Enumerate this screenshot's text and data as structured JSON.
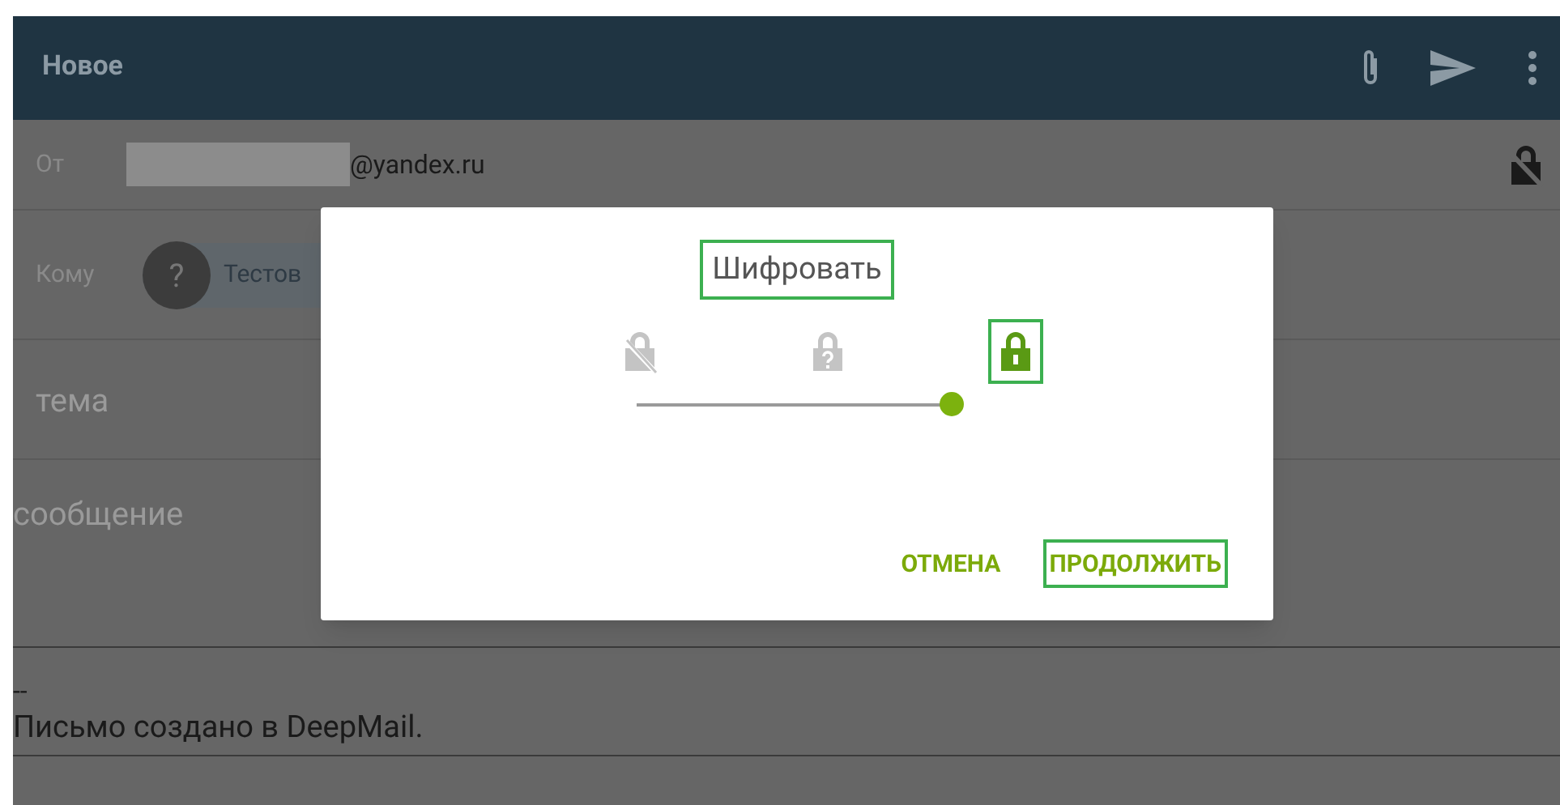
{
  "toolbar": {
    "title": "Новое"
  },
  "from": {
    "label": "От",
    "address": "@yandex.ru"
  },
  "to": {
    "label": "Кому",
    "avatar": "?",
    "recipient": "Тестов"
  },
  "subject": {
    "placeholder": "тема"
  },
  "body": {
    "placeholder": "сообщение"
  },
  "signature": {
    "separator": "--",
    "text": "Письмо создано в DeepMail."
  },
  "dialog": {
    "title": "Шифровать",
    "options": [
      {
        "kind": "unencrypted",
        "selected": false
      },
      {
        "kind": "unknown",
        "selected": false
      },
      {
        "kind": "encrypted",
        "selected": true
      }
    ],
    "slider": {
      "level": 1
    },
    "buttons": [
      {
        "label": "ОТМЕНА",
        "highlighted": false
      },
      {
        "label": "ПРОДОЛЖИТЬ",
        "highlighted": true
      }
    ]
  }
}
